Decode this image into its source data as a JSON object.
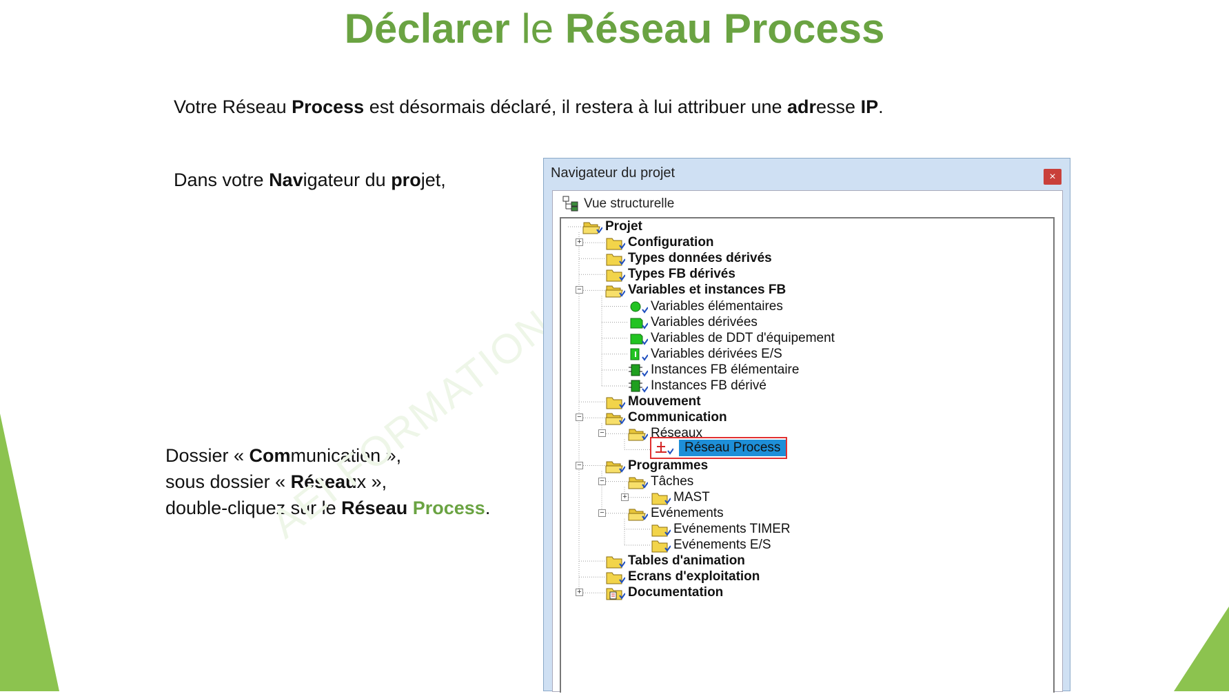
{
  "title": {
    "part1": "Déclarer",
    "part2": " le ",
    "part3": "Réseau Process"
  },
  "line1": {
    "t1": "Votre Réseau ",
    "b1": "Process",
    "t2": " est désormais déclaré, il restera à lui attribuer une ",
    "b2": "adr",
    "t3": "esse ",
    "b3": "IP",
    "t4": "."
  },
  "line2": {
    "t1": "Dans votre ",
    "b1": "Nav",
    "t2": "igateur du ",
    "b2": "pro",
    "t3": "j",
    "b3": "",
    "t4": "et,"
  },
  "para3": {
    "l1a": "Dossier « ",
    "l1b": "Com",
    "l1c": "munication »,",
    "l2a": "sous dossier « ",
    "l2b": "Réseau",
    "l2c": "x »,",
    "l3a": "double-cliquez sur le ",
    "l3b": "Réseau",
    "l3c": " ",
    "l3d": "Process",
    "l3e": "."
  },
  "watermark": "AEI      FORMATION",
  "navigator": {
    "title": "Navigateur du projet",
    "close": "×",
    "view": "Vue structurelle",
    "tree": [
      {
        "label": "Projet",
        "bold": true
      },
      {
        "label": "Configuration",
        "bold": true
      },
      {
        "label": "Types données dérivés",
        "bold": true
      },
      {
        "label": "Types FB dérivés",
        "bold": true
      },
      {
        "label": "Variables et instances FB",
        "bold": true
      },
      {
        "label": "Variables élémentaires",
        "bold": false
      },
      {
        "label": "Variables dérivées",
        "bold": false
      },
      {
        "label": "Variables de DDT d'équipement",
        "bold": false
      },
      {
        "label": "Variables dérivées E/S",
        "bold": false
      },
      {
        "label": "Instances FB élémentaire",
        "bold": false
      },
      {
        "label": "Instances FB dérivé",
        "bold": false
      },
      {
        "label": "Mouvement",
        "bold": true
      },
      {
        "label": "Communication",
        "bold": true
      },
      {
        "label": "Réseaux",
        "bold": false
      },
      {
        "label": "Réseau Process",
        "bold": false
      },
      {
        "label": "Programmes",
        "bold": true
      },
      {
        "label": "Tâches",
        "bold": false
      },
      {
        "label": "MAST",
        "bold": false
      },
      {
        "label": "Evénements",
        "bold": false
      },
      {
        "label": "Evénements TIMER",
        "bold": false
      },
      {
        "label": "Evénements E/S",
        "bold": false
      },
      {
        "label": "Tables d'animation",
        "bold": true
      },
      {
        "label": "Ecrans d'exploitation",
        "bold": true
      },
      {
        "label": "Documentation",
        "bold": true
      }
    ]
  },
  "colors": {
    "accent_green": "#6aa342",
    "selection": "#1e8fd8",
    "highlight_border": "#e03030"
  }
}
